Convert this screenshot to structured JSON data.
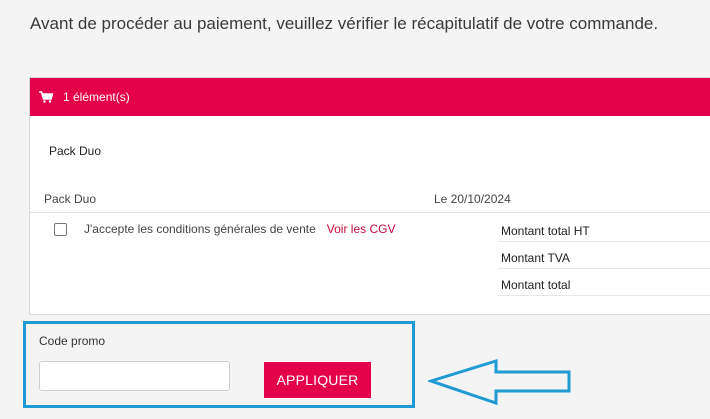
{
  "intro_text": "Avant de procéder au paiement, veuillez vérifier le récapitulatif de votre commande.",
  "cart": {
    "icon": "cart-icon",
    "header_label": "1 élément(s)",
    "header_color": "#e4004b",
    "product_title": "Pack Duo",
    "line_item": {
      "name": "Pack Duo",
      "date": "Le 20/10/2024"
    }
  },
  "cgv": {
    "checked": false,
    "label": "J'accepte les conditions générales de vente",
    "link_label": "Voir les CGV"
  },
  "totals": {
    "ht_label": "Montant total HT",
    "tva_label": "Montant TVA",
    "total_label": "Montant total"
  },
  "promo": {
    "label": "Code promo",
    "value": "",
    "placeholder": "",
    "button_label": "APPLIQUER"
  },
  "annotation": {
    "highlight_color": "#1f9ad3",
    "arrow_icon": "left-arrow-icon"
  }
}
